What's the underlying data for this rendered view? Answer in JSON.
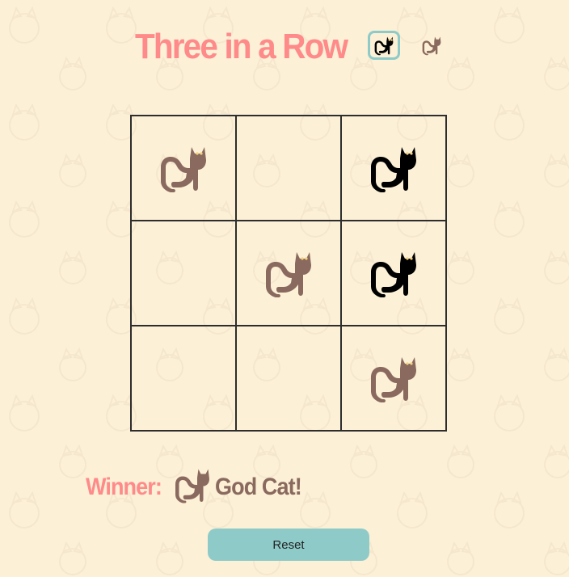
{
  "header": {
    "title": "Three in a Row",
    "player_options": [
      "black-cat",
      "brown-cat"
    ],
    "selected_player": "black-cat"
  },
  "board": {
    "cells": [
      "brown",
      "",
      "black",
      "",
      "brown",
      "black",
      "",
      "",
      "brown"
    ]
  },
  "result": {
    "label": "Winner:",
    "winner_icon": "brown-cat",
    "name": "God Cat!"
  },
  "reset_label": "Reset",
  "colors": {
    "background": "#fcf0d6",
    "accent": "#ff8a8a",
    "brown_cat": "#8a6a5e",
    "black_cat": "#000000",
    "button": "#8ecbc8"
  }
}
